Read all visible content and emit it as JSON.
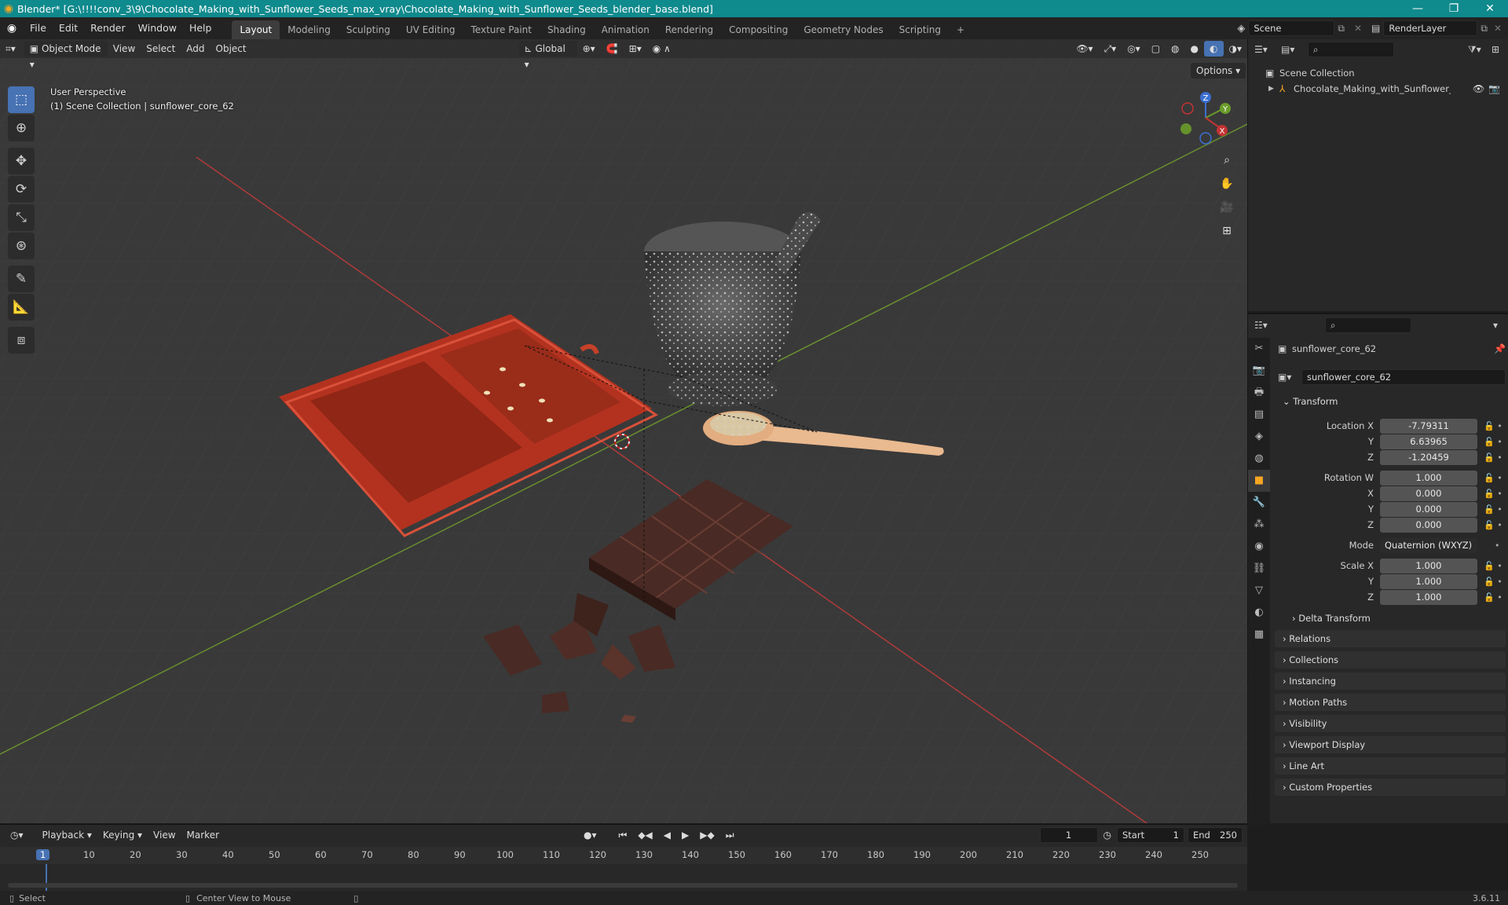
{
  "window": {
    "title": "Blender* [G:\\!!!!conv_3\\9\\Chocolate_Making_with_Sunflower_Seeds_max_vray\\Chocolate_Making_with_Sunflower_Seeds_blender_base.blend]",
    "minimize": "—",
    "maximize": "❐",
    "close": "✕"
  },
  "menu": [
    "File",
    "Edit",
    "Render",
    "Window",
    "Help"
  ],
  "workspaces": [
    "Layout",
    "Modeling",
    "Sculpting",
    "UV Editing",
    "Texture Paint",
    "Shading",
    "Animation",
    "Rendering",
    "Compositing",
    "Geometry Nodes",
    "Scripting"
  ],
  "active_workspace": "Layout",
  "add_workspace": "+",
  "scene": {
    "name": "Scene",
    "render_layer": "RenderLayer"
  },
  "viewport": {
    "mode": "Object Mode",
    "menus": [
      "View",
      "Select",
      "Add",
      "Object"
    ],
    "transform_orientation": "Global",
    "options": "Options",
    "perspective": "User Perspective",
    "collection_info": "(1) Scene Collection | sunflower_core_62",
    "gizmo_axes": {
      "x": "X",
      "y": "Y",
      "z": "Z"
    }
  },
  "outliner": {
    "root": "Scene Collection",
    "items": [
      "Chocolate_Making_with_Sunflower_Seeds"
    ]
  },
  "properties": {
    "object_name": "sunflower_core_62",
    "data_name": "sunflower_core_62",
    "transform_label": "Transform",
    "location_label": "Location X",
    "location": {
      "x": "-7.79311",
      "y": "6.63965",
      "z": "-1.20459"
    },
    "rotation_label": "Rotation W",
    "rotation": {
      "w": "1.000",
      "x": "0.000",
      "y": "0.000",
      "z": "0.000"
    },
    "mode_label": "Mode",
    "mode": "Quaternion (WXYZ)",
    "scale_label": "Scale X",
    "scale": {
      "x": "1.000",
      "y": "1.000",
      "z": "1.000"
    },
    "axis_y": "Y",
    "axis_z": "Z",
    "axis_x": "X",
    "delta": "Delta Transform",
    "panels": [
      "Relations",
      "Collections",
      "Instancing",
      "Motion Paths",
      "Visibility",
      "Viewport Display",
      "Line Art",
      "Custom Properties"
    ]
  },
  "timeline": {
    "menus": [
      "Playback",
      "Keying",
      "View",
      "Marker"
    ],
    "current_frame": "1",
    "start_label": "Start",
    "start": "1",
    "end_label": "End",
    "end": "250",
    "ticks": [
      "1",
      "10",
      "20",
      "30",
      "40",
      "50",
      "60",
      "70",
      "80",
      "90",
      "100",
      "110",
      "120",
      "130",
      "140",
      "150",
      "160",
      "170",
      "180",
      "190",
      "200",
      "210",
      "220",
      "230",
      "240",
      "250"
    ]
  },
  "status": {
    "select": "Select",
    "center": "Center View to Mouse",
    "version": "3.6.11"
  },
  "colors": {
    "accent": "#4772b3",
    "title_bar": "#0f8a8d",
    "active_orange": "#f5a623"
  }
}
